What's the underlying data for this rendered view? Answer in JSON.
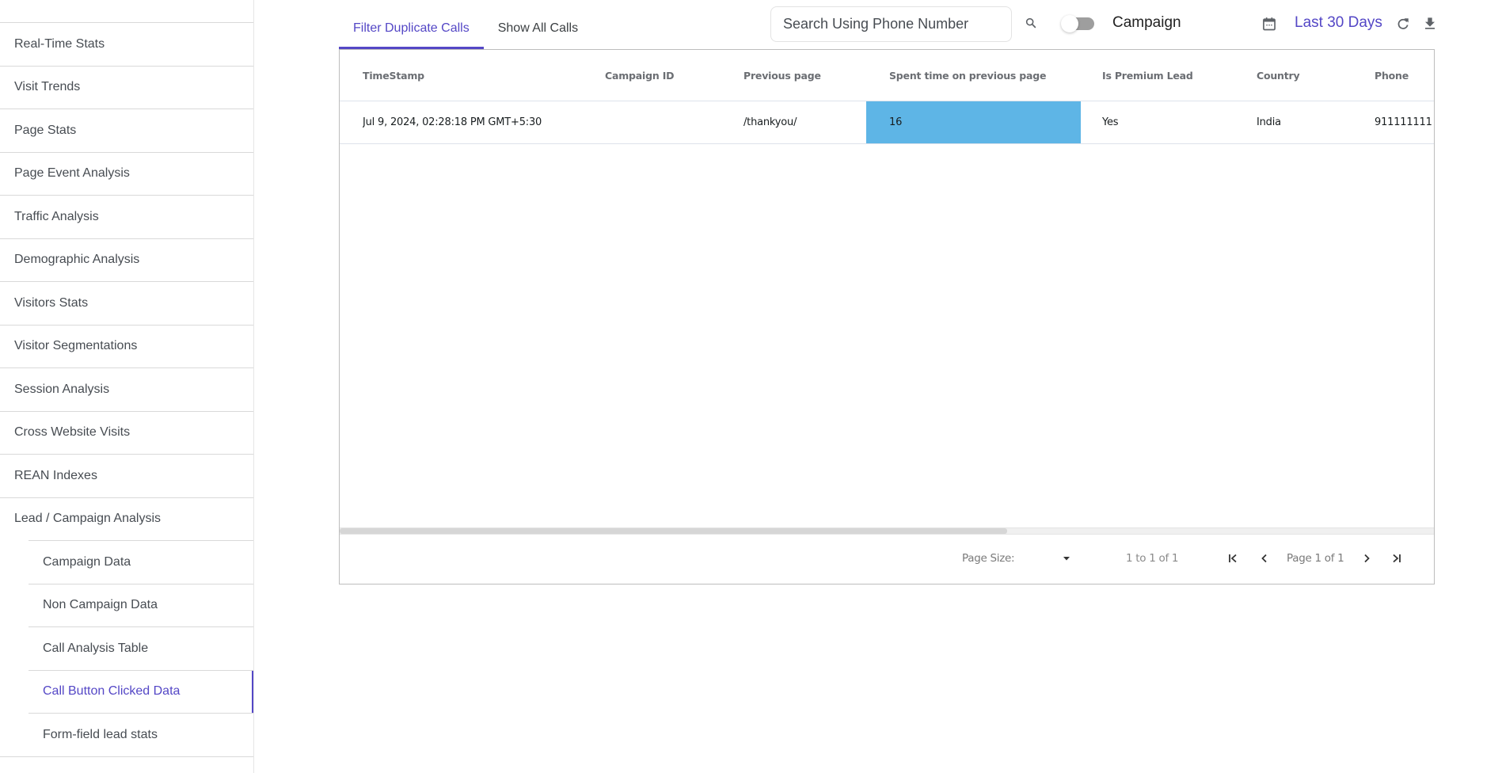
{
  "sidebar": {
    "items": [
      {
        "label": "Real-Time Stats"
      },
      {
        "label": "Visit Trends"
      },
      {
        "label": "Page Stats"
      },
      {
        "label": "Page Event Analysis"
      },
      {
        "label": "Traffic Analysis"
      },
      {
        "label": "Demographic Analysis"
      },
      {
        "label": "Visitors Stats"
      },
      {
        "label": "Visitor Segmentations"
      },
      {
        "label": "Session Analysis"
      },
      {
        "label": "Cross Website Visits"
      },
      {
        "label": "REAN Indexes"
      },
      {
        "label": "Lead / Campaign Analysis"
      }
    ],
    "sub_items": [
      {
        "label": "Campaign Data"
      },
      {
        "label": "Non Campaign Data"
      },
      {
        "label": "Call Analysis Table"
      },
      {
        "label": "Call Button Clicked Data",
        "active": true
      },
      {
        "label": "Form-field lead stats"
      }
    ]
  },
  "tabs": [
    {
      "label": "Filter Duplicate Calls",
      "active": true
    },
    {
      "label": "Show All Calls",
      "active": false
    }
  ],
  "toolbar": {
    "search_placeholder": "Search Using Phone Number",
    "search_value": "",
    "search_icon": "search-icon",
    "toggle_label": "Campaign",
    "toggle_on": false,
    "calendar_icon": "calendar-icon",
    "date_range": "Last 30 Days",
    "refresh_icon": "refresh-icon",
    "download_icon": "download-icon"
  },
  "table": {
    "columns": [
      "TimeStamp",
      "Campaign ID",
      "Previous page",
      "Spent time on previous page",
      "Is Premium Lead",
      "Country",
      "Phone"
    ],
    "rows": [
      [
        "Jul 9, 2024, 02:28:18 PM GMT+5:30",
        "",
        "/thankyou/",
        "16",
        "Yes",
        "India",
        "911111111"
      ]
    ],
    "highlight_color": "#5eb5e6",
    "horizontal_scroll_fraction": 0.61
  },
  "pagination": {
    "page_size_label": "Page Size:",
    "page_size_value": "",
    "range_text": "1 to 1 of 1",
    "page_text": "Page 1 of 1"
  },
  "colors": {
    "accent": "#5447c6",
    "text": "#474c52",
    "border": "#d9d9d9"
  }
}
